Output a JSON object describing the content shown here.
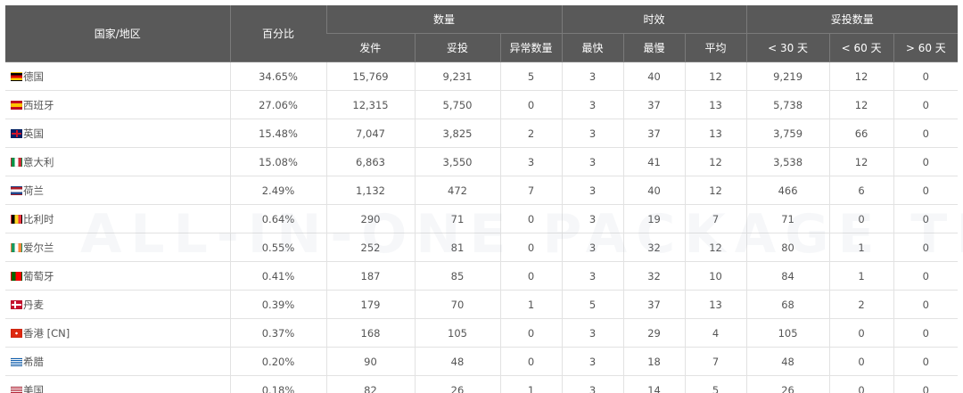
{
  "headers": {
    "country": "国家/地区",
    "percent": "百分比",
    "group_quantity": "数量",
    "group_timeliness": "时效",
    "group_delivered": "妥投数量",
    "shipped": "发件",
    "delivered": "妥投",
    "abnormal": "异常数量",
    "fastest": "最快",
    "slowest": "最慢",
    "average": "平均",
    "lt30": "< 30 天",
    "lt60": "< 60 天",
    "gt60": "> 60 天"
  },
  "rows": [
    {
      "flag": "flag-de",
      "country": "德国",
      "percent": "34.65%",
      "shipped": "15,769",
      "delivered": "9,231",
      "abnormal": "5",
      "fastest": "3",
      "slowest": "40",
      "average": "12",
      "lt30": "9,219",
      "lt60": "12",
      "gt60": "0"
    },
    {
      "flag": "flag-es",
      "country": "西班牙",
      "percent": "27.06%",
      "shipped": "12,315",
      "delivered": "5,750",
      "abnormal": "0",
      "fastest": "3",
      "slowest": "37",
      "average": "13",
      "lt30": "5,738",
      "lt60": "12",
      "gt60": "0"
    },
    {
      "flag": "flag-gb",
      "country": "英国",
      "percent": "15.48%",
      "shipped": "7,047",
      "delivered": "3,825",
      "abnormal": "2",
      "fastest": "3",
      "slowest": "37",
      "average": "13",
      "lt30": "3,759",
      "lt60": "66",
      "gt60": "0"
    },
    {
      "flag": "flag-it",
      "country": "意大利",
      "percent": "15.08%",
      "shipped": "6,863",
      "delivered": "3,550",
      "abnormal": "3",
      "fastest": "3",
      "slowest": "41",
      "average": "12",
      "lt30": "3,538",
      "lt60": "12",
      "gt60": "0"
    },
    {
      "flag": "flag-nl",
      "country": "荷兰",
      "percent": "2.49%",
      "shipped": "1,132",
      "delivered": "472",
      "abnormal": "7",
      "fastest": "3",
      "slowest": "40",
      "average": "12",
      "lt30": "466",
      "lt60": "6",
      "gt60": "0"
    },
    {
      "flag": "flag-be",
      "country": "比利时",
      "percent": "0.64%",
      "shipped": "290",
      "delivered": "71",
      "abnormal": "0",
      "fastest": "3",
      "slowest": "19",
      "average": "7",
      "lt30": "71",
      "lt60": "0",
      "gt60": "0"
    },
    {
      "flag": "flag-ie",
      "country": "爱尔兰",
      "percent": "0.55%",
      "shipped": "252",
      "delivered": "81",
      "abnormal": "0",
      "fastest": "3",
      "slowest": "32",
      "average": "12",
      "lt30": "80",
      "lt60": "1",
      "gt60": "0"
    },
    {
      "flag": "flag-pt",
      "country": "葡萄牙",
      "percent": "0.41%",
      "shipped": "187",
      "delivered": "85",
      "abnormal": "0",
      "fastest": "3",
      "slowest": "32",
      "average": "10",
      "lt30": "84",
      "lt60": "1",
      "gt60": "0"
    },
    {
      "flag": "flag-dk",
      "country": "丹麦",
      "percent": "0.39%",
      "shipped": "179",
      "delivered": "70",
      "abnormal": "1",
      "fastest": "5",
      "slowest": "37",
      "average": "13",
      "lt30": "68",
      "lt60": "2",
      "gt60": "0"
    },
    {
      "flag": "flag-hk",
      "country": "香港 [CN]",
      "percent": "0.37%",
      "shipped": "168",
      "delivered": "105",
      "abnormal": "0",
      "fastest": "3",
      "slowest": "29",
      "average": "4",
      "lt30": "105",
      "lt60": "0",
      "gt60": "0"
    },
    {
      "flag": "flag-gr",
      "country": "希腊",
      "percent": "0.20%",
      "shipped": "90",
      "delivered": "48",
      "abnormal": "0",
      "fastest": "3",
      "slowest": "18",
      "average": "7",
      "lt30": "48",
      "lt60": "0",
      "gt60": "0"
    },
    {
      "flag": "flag-us",
      "country": "美国",
      "percent": "0.18%",
      "shipped": "82",
      "delivered": "26",
      "abnormal": "1",
      "fastest": "3",
      "slowest": "14",
      "average": "5",
      "lt30": "26",
      "lt60": "0",
      "gt60": "0"
    }
  ],
  "watermark": {
    "text": "ALL-IN-ONE PACKAGE TRACKING"
  }
}
